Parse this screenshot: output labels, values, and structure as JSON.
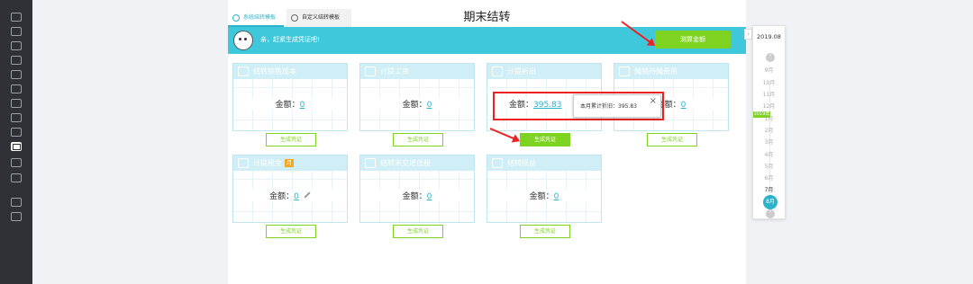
{
  "title": "期末结转",
  "tabs": [
    {
      "label": "系统结转模板"
    },
    {
      "label": "自定义结转模板"
    }
  ],
  "banner": {
    "message": "亲，赶紧生成凭证吧!",
    "calc_button": "测算金额"
  },
  "amount_label": "金额：",
  "cards": [
    {
      "title": "结转销售成本",
      "amount": "0",
      "button": "生成凭证"
    },
    {
      "title": "计提工资",
      "amount": "0",
      "button": "生成凭证"
    },
    {
      "title": "计提折旧",
      "amount": "395.83",
      "button": "生成凭证"
    },
    {
      "title": "摊销待摊费用",
      "amount": "0",
      "button": "生成凭证"
    },
    {
      "title": "计提税金",
      "badge": "月",
      "amount": "0",
      "button": "生成凭证"
    },
    {
      "title": "结转未交增值税",
      "amount": "0",
      "button": "生成凭证"
    },
    {
      "title": "结转损益",
      "amount": "0",
      "button": "生成凭证"
    }
  ],
  "tooltip": {
    "text": "本月累计折旧：395.83",
    "close": "×"
  },
  "date_panel": {
    "year": "2019.08",
    "year_tag": "2019年",
    "months": [
      "9月",
      "10月",
      "11月",
      "12月",
      "1月",
      "2月",
      "3月",
      "4月",
      "5月",
      "6月",
      "7月",
      "8月"
    ],
    "selected": "8月"
  },
  "colors": {
    "accent": "#2bb3c9",
    "banner": "#3fc8dc",
    "button": "#7ed321",
    "highlight": "#ee2222"
  },
  "icons": [
    "menu-icon",
    "add-icon",
    "chart-icon",
    "ledger-icon",
    "report-icon",
    "assets-icon",
    "invoice-icon",
    "cash-icon",
    "closing-icon",
    "tax-icon",
    "settings-icon",
    "export-icon",
    "undo-icon"
  ]
}
